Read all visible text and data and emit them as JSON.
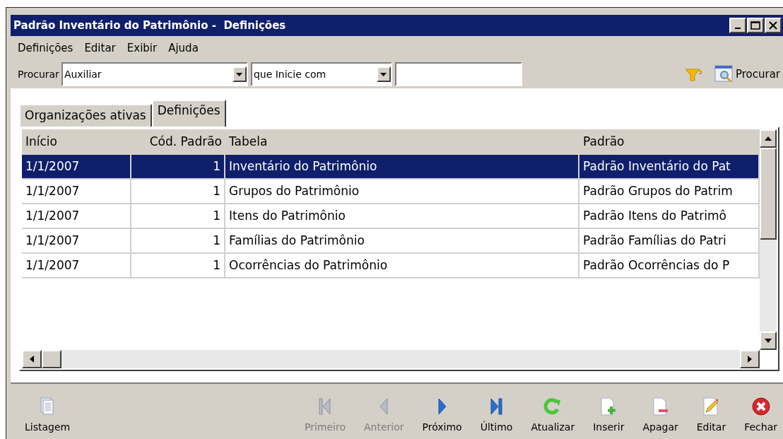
{
  "window": {
    "title": "Padrão Inventário do Patrimônio -  Definições"
  },
  "menu": [
    "Definições",
    "Editar",
    "Exibir",
    "Ajuda"
  ],
  "search": {
    "label": "Procurar",
    "field": "Auxiliar",
    "condition": "que Inicie com",
    "button": "Procurar"
  },
  "tabs": [
    {
      "label": "Organizações ativas",
      "selected": false
    },
    {
      "label": "Definições",
      "selected": true
    }
  ],
  "table": {
    "columns": [
      "Início",
      "Cód. Padrão",
      "Tabela",
      "Padrão"
    ],
    "rows": [
      {
        "cells": [
          "1/1/2007",
          "1",
          "Inventário do Patrimônio",
          "Padrão Inventário do Pat"
        ],
        "selected": true
      },
      {
        "cells": [
          "1/1/2007",
          "1",
          "Grupos do Patrimônio",
          "Padrão Grupos do Patrim"
        ],
        "selected": false
      },
      {
        "cells": [
          "1/1/2007",
          "1",
          "Itens do Patrimônio",
          "Padrão Itens do Patrimô"
        ],
        "selected": false
      },
      {
        "cells": [
          "1/1/2007",
          "1",
          "Famílias do Patrimônio",
          "Padrão Famílias do Patri"
        ],
        "selected": false
      },
      {
        "cells": [
          "1/1/2007",
          "1",
          "Ocorrências do Patrimônio",
          "Padrão Ocorrências do P"
        ],
        "selected": false
      }
    ]
  },
  "toolbar": {
    "left": [
      {
        "label": "Listagem",
        "kind": "list",
        "disabled": false
      }
    ],
    "right": [
      {
        "label": "Primeiro",
        "kind": "first",
        "disabled": true
      },
      {
        "label": "Anterior",
        "kind": "prev",
        "disabled": true
      },
      {
        "label": "Próximo",
        "kind": "next",
        "disabled": false
      },
      {
        "label": "Último",
        "kind": "last",
        "disabled": false
      },
      {
        "label": "Atualizar",
        "kind": "refresh",
        "disabled": false
      },
      {
        "label": "Inserir",
        "kind": "insert",
        "disabled": false
      },
      {
        "label": "Apagar",
        "kind": "delete",
        "disabled": false
      },
      {
        "label": "Editar",
        "kind": "edit",
        "disabled": false
      },
      {
        "label": "Fechar",
        "kind": "close",
        "disabled": false
      }
    ]
  }
}
